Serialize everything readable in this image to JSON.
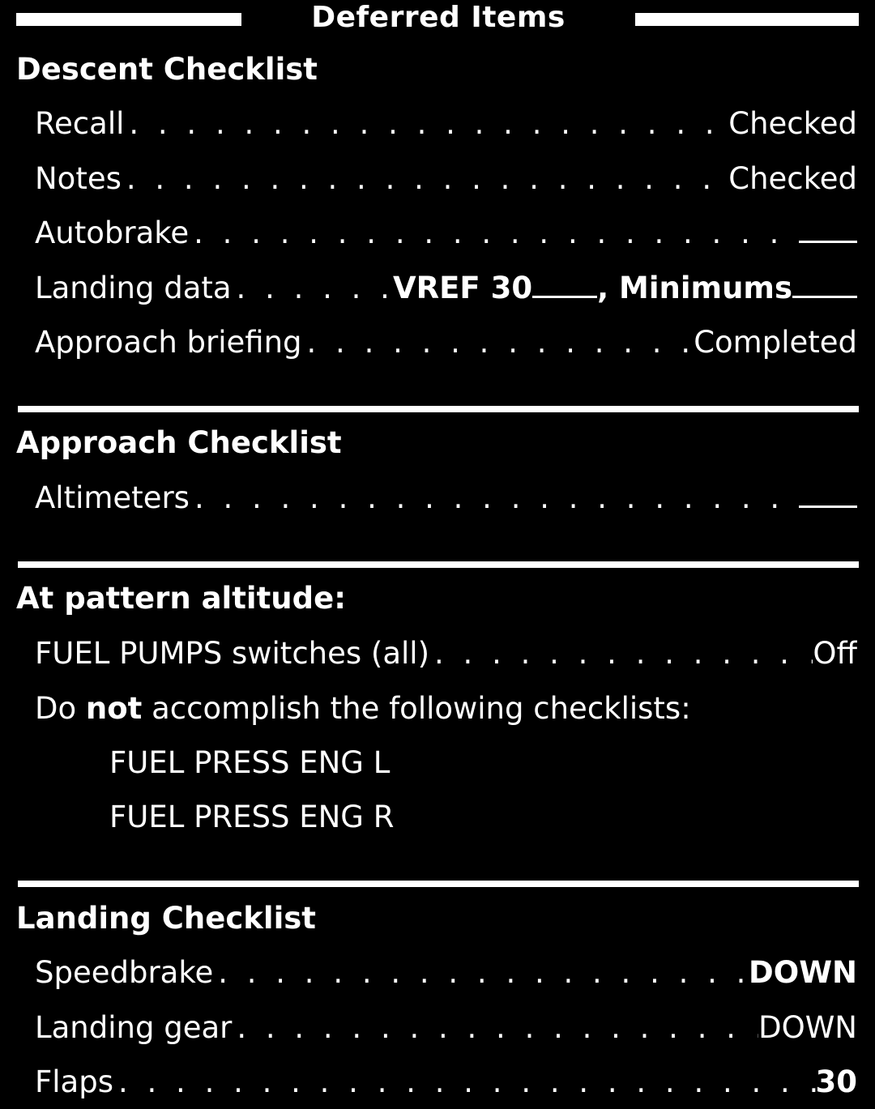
{
  "title": "Deferred Items",
  "sections": {
    "descent": {
      "heading": "Descent Checklist",
      "items": [
        {
          "label": "Recall",
          "value": "Checked"
        },
        {
          "label": "Notes",
          "value": "Checked"
        },
        {
          "label": "Autobrake",
          "value": ""
        },
        {
          "label": "Landing data",
          "value_prefix": "VREF 30",
          "value_middle": ", Minimums"
        },
        {
          "label": "Approach briefing",
          "value": "Completed"
        }
      ]
    },
    "approach": {
      "heading": "Approach Checklist",
      "items": [
        {
          "label": "Altimeters",
          "value": ""
        }
      ]
    },
    "pattern": {
      "heading": "At pattern altitude:",
      "items": [
        {
          "label": "FUEL PUMPS switches (all)",
          "value": "Off"
        }
      ],
      "note": {
        "before": "Do ",
        "emphasis": "not",
        "after": " accomplish the following checklists:"
      },
      "checklists": [
        "FUEL PRESS ENG L",
        "FUEL PRESS ENG R"
      ]
    },
    "landing": {
      "heading": "Landing Checklist",
      "items": [
        {
          "label": "Speedbrake",
          "value": "DOWN"
        },
        {
          "label": "Landing gear",
          "value": "DOWN"
        },
        {
          "label": "Flaps",
          "value": "30"
        }
      ]
    }
  }
}
